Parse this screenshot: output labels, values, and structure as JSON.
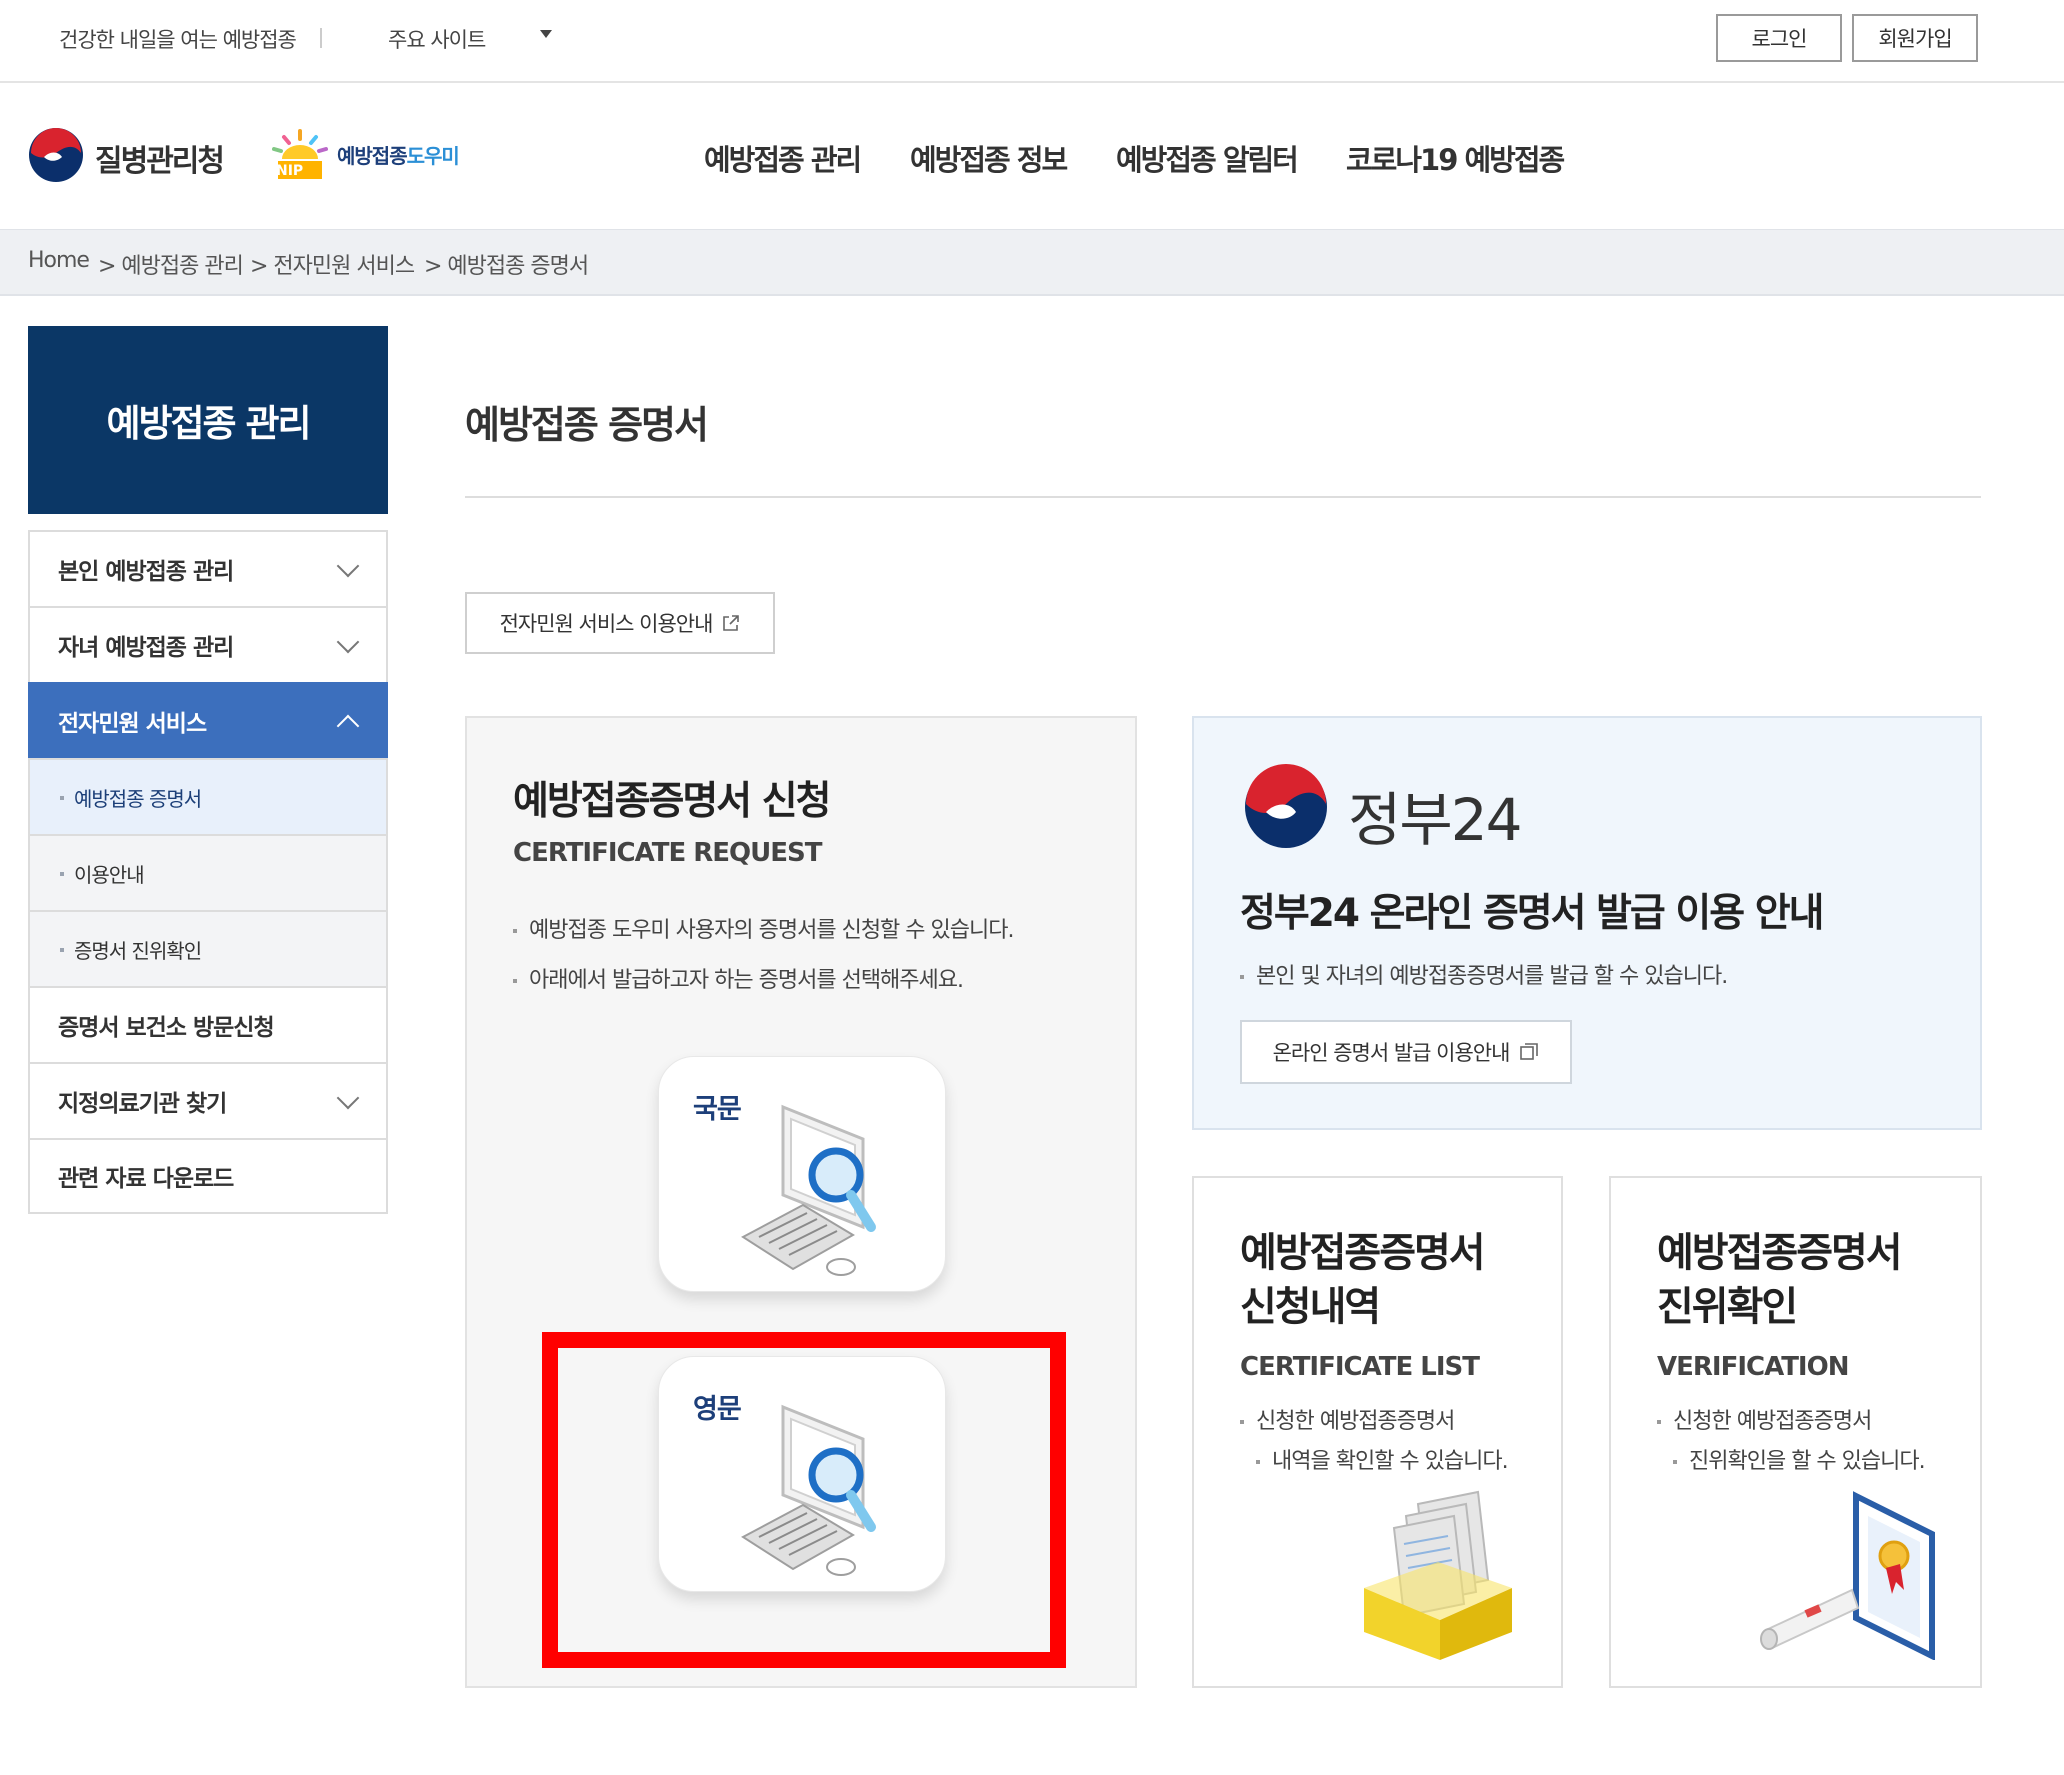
{
  "top_bar": {
    "slogan": "건강한 내일을 여는 예방접종",
    "sites_label": "주요 사이트",
    "login_label": "로그인",
    "signup_label": "회원가입"
  },
  "header": {
    "kdca_name": "질병관리청",
    "nip_name_dark": "예방접종",
    "nip_name_blue": "도우미",
    "nip_badge": "NIP",
    "nav": [
      "예방접종 관리",
      "예방접종 정보",
      "예방접종 알림터",
      "코로나19 예방접종"
    ]
  },
  "breadcrumb": [
    "Home",
    "> 예방접종 관리",
    "> 전자민원 서비스",
    "> 예방접종 증명서"
  ],
  "sidebar": {
    "heading": "예방접종 관리",
    "items": [
      {
        "label": "본인 예방접종 관리"
      },
      {
        "label": "자녀 예방접종 관리"
      },
      {
        "label": "전자민원 서비스"
      },
      {
        "label": "예방접종 증명서"
      },
      {
        "label": "이용안내"
      },
      {
        "label": "증명서 진위확인"
      },
      {
        "label": "증명서 보건소 방문신청"
      },
      {
        "label": "지정의료기관 찾기"
      },
      {
        "label": "관련 자료 다운로드"
      }
    ]
  },
  "main": {
    "title": "예방접종 증명서",
    "guide_button": "전자민원 서비스 이용안내",
    "request": {
      "title": "예방접종증명서 신청",
      "subtitle": "CERTIFICATE REQUEST",
      "desc": [
        "예방접종 도우미 사용자의 증명서를 신청할 수 있습니다.",
        "아래에서 발급하고자 하는 증명서를 선택해주세요."
      ],
      "tiles": [
        {
          "label": "국문"
        },
        {
          "label": "영문"
        }
      ]
    },
    "gov24": {
      "logo_text": "정부24",
      "title": "정부24 온라인 증명서 발급 이용 안내",
      "desc": "본인 및 자녀의 예방접종증명서를 발급 할 수 있습니다.",
      "button": "온라인 증명서 발급 이용안내"
    },
    "list_card": {
      "title_1": "예방접종증명서",
      "title_2": "신청내역",
      "subtitle": "CERTIFICATE LIST",
      "desc_1": "신청한 예방접종증명서",
      "desc_2": "내역을 확인할 수 있습니다."
    },
    "verify_card": {
      "title_1": "예방접종증명서",
      "title_2": "진위확인",
      "subtitle": "VERIFICATION",
      "desc_1": "신청한 예방접종증명서",
      "desc_2": "진위확인을 할 수 있습니다."
    }
  },
  "colors": {
    "sidebar_heading_bg": "#0b3766",
    "sidebar_active_bg": "#3c6fbd",
    "highlight_red": "#ff0000",
    "gov_panel_bg": "#f0f6fc"
  },
  "icons": [
    "kdca-logo-icon",
    "nip-logo-icon",
    "external-link-icon",
    "computer-search-icon",
    "gov24-logo-icon",
    "new-window-icon",
    "document-box-icon",
    "certificate-scroll-icon",
    "chevron-down-icon",
    "chevron-up-icon"
  ]
}
